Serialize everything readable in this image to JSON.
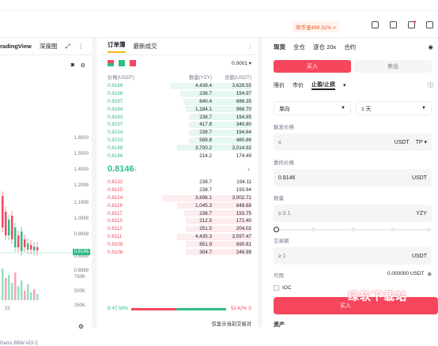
{
  "header": {
    "promo": "奖币宝499.32% >"
  },
  "chart": {
    "tabs": [
      "radingView",
      "深度图"
    ],
    "axis": [
      "1.6000",
      "1.5000",
      "1.4000",
      "1.2999",
      "1.1999",
      "1.0999",
      "0.9999",
      "0.8999",
      "0.6999"
    ],
    "price_tag": "0.8146",
    "volume_axis": [
      "750K",
      "500K",
      "250K"
    ],
    "x_label": "22",
    "indicators": "Rams  BBW  ADI  C",
    "colors": {
      "up": "#2ebd85",
      "down": "#f6465d"
    }
  },
  "orderbook": {
    "tabs": [
      "订单簿",
      "最新成交"
    ],
    "tick": "0.0001",
    "headers": {
      "price": "价格(USDT)",
      "qty": "数量(YZY)",
      "total": "总额(USDT)"
    },
    "bids_top": [
      {
        "p": "0.8169",
        "q": "4,439.4",
        "t": "3,626.55",
        "w": 0.55
      },
      {
        "p": "0.8168",
        "q": "238.7",
        "t": "194.97",
        "w": 0.48
      },
      {
        "p": "0.8167",
        "q": "840.4",
        "t": "686.35",
        "w": 0.46
      },
      {
        "p": "0.8164",
        "q": "1,184.1",
        "t": "966.70",
        "w": 0.44
      },
      {
        "p": "0.8163",
        "q": "238.7",
        "t": "194.85",
        "w": 0.42
      },
      {
        "p": "0.8157",
        "q": "417.8",
        "t": "340.80",
        "w": 0.42
      },
      {
        "p": "0.8154",
        "q": "238.7",
        "t": "194.64",
        "w": 0.42
      },
      {
        "p": "0.8153",
        "q": "589.8",
        "t": "480.86",
        "w": 0.42
      },
      {
        "p": "0.8148",
        "q": "3,700.2",
        "t": "3,014.92",
        "w": 0.5
      },
      {
        "p": "0.8146",
        "q": "214.2",
        "t": "174.49",
        "w": 0.0
      }
    ],
    "mid_price": "0.8146",
    "asks": [
      {
        "p": "0.8132",
        "q": "238.7",
        "t": "194.11",
        "w": 0.0
      },
      {
        "p": "0.8125",
        "q": "238.7",
        "t": "193.94",
        "w": 0.0
      },
      {
        "p": "0.8124",
        "q": "3,696.1",
        "t": "3,002.71",
        "w": 0.6
      },
      {
        "p": "0.8119",
        "q": "1,045.3",
        "t": "848.68",
        "w": 0.5
      },
      {
        "p": "0.8117",
        "q": "238.7",
        "t": "193.75",
        "w": 0.45
      },
      {
        "p": "0.8113",
        "q": "212.5",
        "t": "172.40",
        "w": 0.44
      },
      {
        "p": "0.8112",
        "q": "251.5",
        "t": "204.02",
        "w": 0.44
      },
      {
        "p": "0.8111",
        "q": "4,435.3",
        "t": "3,597.47",
        "w": 0.5
      },
      {
        "p": "0.8109",
        "q": "851.9",
        "t": "690.81",
        "w": 0.44
      },
      {
        "p": "0.8106",
        "q": "304.7",
        "t": "246.99",
        "w": 0.44
      }
    ],
    "ratio": {
      "buy": "B 47.58%",
      "sell": "52.42% S",
      "buy_frac": 0.4758
    },
    "bottom_link": "仅显示当前交易对"
  },
  "trade": {
    "tabs": [
      "现货",
      "全仓",
      "逐仓 20x",
      "合约"
    ],
    "buy": "买入",
    "sell": "卖出",
    "order_types": [
      "限价",
      "市价",
      "止盈/止损"
    ],
    "direction": "单向",
    "duration": "1 天",
    "trigger_label": "触发价格",
    "trigger_ph": "≤",
    "trigger_unit": "USDT",
    "trigger_mode": "TP",
    "limit_label": "委托价格",
    "limit_value": "0.8146",
    "limit_unit": "USDT",
    "qty_label": "数量",
    "qty_ph": "≥ 0.1",
    "qty_unit": "YZY",
    "amount_label": "交易额",
    "amount_ph": "≥ 1",
    "amount_unit": "USDT",
    "avail_label": "可用",
    "avail_value": "0.000000 USDT",
    "ioc": "IOC",
    "submit": "买入",
    "watermark": "绿软下载站",
    "assets": "资产"
  }
}
